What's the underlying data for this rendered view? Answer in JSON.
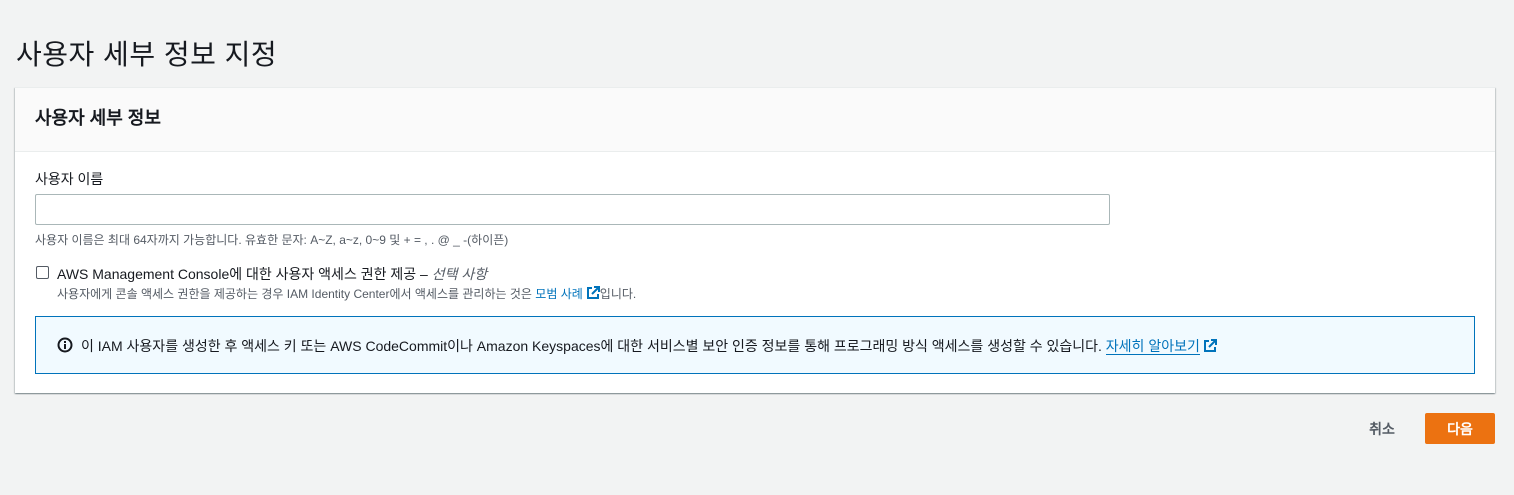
{
  "page": {
    "title": "사용자 세부 정보 지정"
  },
  "card": {
    "header": "사용자 세부 정보",
    "username": {
      "label": "사용자 이름",
      "value": "",
      "constraint": "사용자 이름은 최대 64자까지 가능합니다. 유효한 문자: A~Z, a~z, 0~9 및 + = , . @ _ -(하이픈)"
    },
    "console_access": {
      "label": "AWS Management Console에 대한 사용자 액세스 권한 제공 –",
      "optional": "선택 사항",
      "desc_prefix": "사용자에게 콘솔 액세스 권한을 제공하는 경우 IAM Identity Center에서 액세스를 관리하는 것은 ",
      "desc_link": "모범 사례",
      "desc_suffix": "입니다.",
      "checked": false
    },
    "info_alert": {
      "text": "이 IAM 사용자를 생성한 후 액세스 키 또는 AWS CodeCommit이나 Amazon Keyspaces에 대한 서비스별 보안 인증 정보를 통해 프로그래밍 방식 액세스를 생성할 수 있습니다. ",
      "link": "자세히 알아보기",
      "icon": "info-icon"
    }
  },
  "actions": {
    "cancel": "취소",
    "next": "다음"
  },
  "colors": {
    "accent": "#0073bb",
    "primary_button": "#ec7211"
  }
}
